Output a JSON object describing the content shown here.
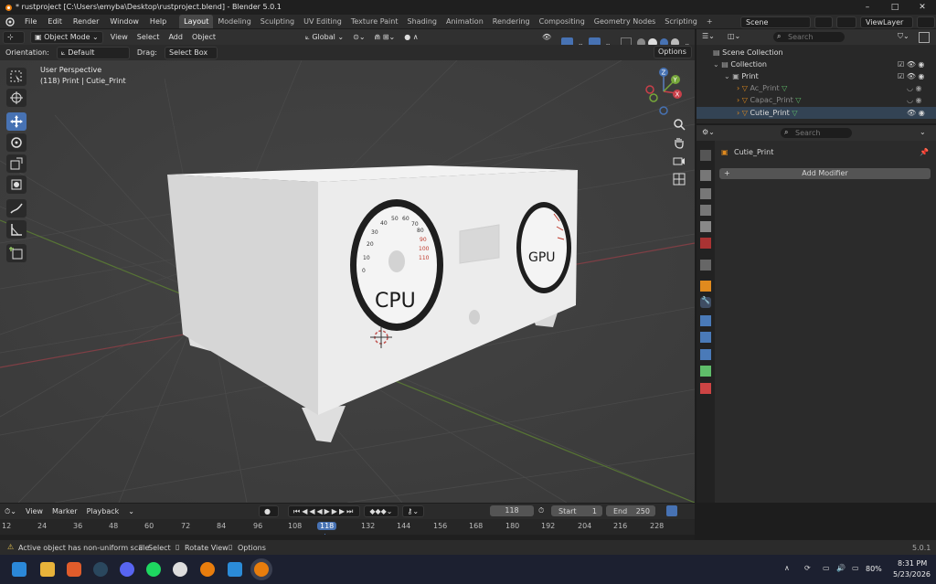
{
  "window": {
    "title": "* rustproject [C:\\Users\\emyba\\Desktop\\rustproject.blend] - Blender 5.0.1",
    "controls": [
      "–",
      "□",
      "✕"
    ]
  },
  "topbar": {
    "menus": [
      "File",
      "Edit",
      "Render",
      "Window",
      "Help"
    ],
    "workspaces": [
      "Layout",
      "Modeling",
      "Sculpting",
      "UV Editing",
      "Texture Paint",
      "Shading",
      "Animation",
      "Rendering",
      "Compositing",
      "Geometry Nodes",
      "Scripting"
    ],
    "active_workspace": "Layout",
    "add_workspace": "+",
    "scene": "Scene",
    "view_layer": "ViewLayer"
  },
  "viewport_header": {
    "mode": "Object Mode",
    "menus": [
      "View",
      "Select",
      "Add",
      "Object"
    ],
    "transform_orientation": "Global"
  },
  "tool_settings": {
    "orientation_label": "Orientation:",
    "orientation_value": "Default",
    "drag_label": "Drag:",
    "drag_value": "Select Box",
    "options": "Options"
  },
  "viewport": {
    "perspective": "User Perspective",
    "object_info": "(118) Print | Cutie_Print",
    "gizmo_labels": {
      "x": "X",
      "y": "Y",
      "z": "Z"
    },
    "gauge_cpu_label": "CPU",
    "gauge_gpu_label": "GPU",
    "cpu_ticks": [
      "0",
      "10",
      "20",
      "30",
      "40",
      "50",
      "60",
      "70",
      "80",
      "90",
      "100",
      "110"
    ]
  },
  "timeline": {
    "menus": [
      "View",
      "Marker",
      "Playback"
    ],
    "current_frame": "118",
    "start_label": "Start",
    "start_value": "1",
    "end_label": "End",
    "end_value": "250",
    "ruler": [
      "12",
      "24",
      "36",
      "48",
      "60",
      "72",
      "84",
      "96",
      "108",
      "118",
      "132",
      "144",
      "156",
      "168",
      "180",
      "192",
      "204",
      "216",
      "228"
    ]
  },
  "statusbar": {
    "message": "Active object has non-uniform scale",
    "hint_select": "Select",
    "hint_rotate": "Rotate View",
    "hint_options": "Options",
    "version": "5.0.1"
  },
  "outliner": {
    "search_placeholder": "Search",
    "root": "Scene Collection",
    "collection": "Collection",
    "parent": "Print",
    "children": [
      "Ac_Print",
      "Capac_Print",
      "Cutie_Print"
    ]
  },
  "properties": {
    "search_placeholder": "Search",
    "object_name": "Cutie_Print",
    "add_modifier": "Add Modifier"
  },
  "taskbar": {
    "battery": "80%",
    "time": "8:31 PM",
    "date": "5/23/2026"
  },
  "colors": {
    "accent": "#4772b3",
    "background": "#3d3d3d",
    "object_orange": "#e08a1e",
    "axis_red": "#c9404a",
    "axis_green": "#76a63a"
  }
}
